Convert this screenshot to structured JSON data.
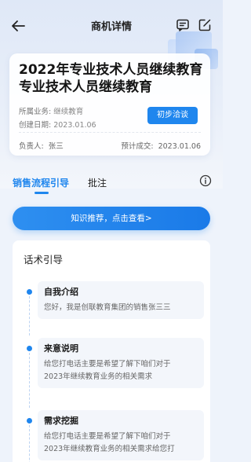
{
  "nav": {
    "title": "商机详情"
  },
  "card": {
    "title_line1": "2022年专业技术人员继续教育",
    "title_line2": "专业技术人员继续教育",
    "business_label": "所属业务:",
    "business_value": "继续教育",
    "created_label": "创建日期:",
    "created_value": "2023.01.06",
    "status": "初步洽谈",
    "owner_label": "负责人:",
    "owner_value": "张三",
    "deal_label": "预计成交:",
    "deal_value": "2023.01.06"
  },
  "tabs": [
    {
      "label": "销售流程引导",
      "active": true
    },
    {
      "label": "批注",
      "active": false
    }
  ],
  "banner": {
    "label": "知识推荐，点击查看>"
  },
  "panel": {
    "title": "话术引导",
    "steps": [
      {
        "title": "自我介绍",
        "desc": "您好，我是创联教育集团的销售张三三"
      },
      {
        "title": "来意说明",
        "desc_line1": "给您打电话主要是希望了解下咱们对于",
        "desc_line2": "2023年继续教育业务的相关需求"
      },
      {
        "title": "需求挖掘",
        "desc_line1": "给您打电话主要是希望了解下咱们对于",
        "desc_line2": "2023年继续教育业务的相关需求给您打"
      }
    ]
  },
  "colors": {
    "accent": "#1f86ee",
    "background": "#eef3fb"
  },
  "icons": [
    "back-arrow-icon",
    "message-icon",
    "edit-icon",
    "info-icon"
  ]
}
